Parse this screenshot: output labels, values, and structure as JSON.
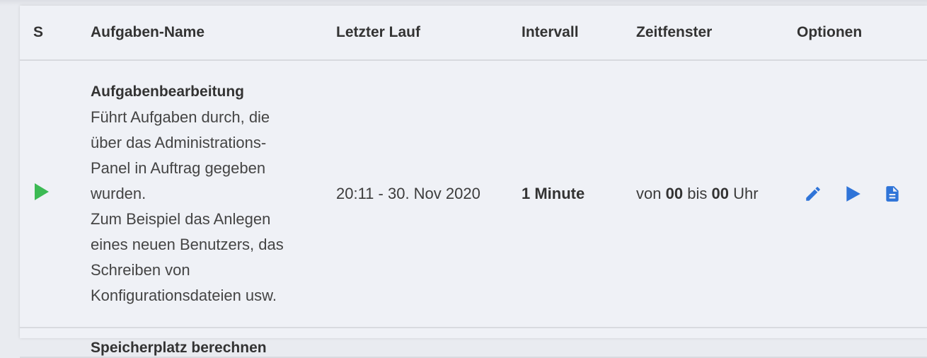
{
  "colors": {
    "status_green": "#3cba54",
    "action_blue": "#2f74d8"
  },
  "table": {
    "headers": {
      "status": "S",
      "name": "Aufgaben-Name",
      "last_run": "Letzter Lauf",
      "interval": "Intervall",
      "window": "Zeitfenster",
      "options": "Optionen"
    },
    "rows": [
      {
        "status_icon": "play-icon",
        "title": "Aufgabenbearbeitung",
        "desc_lines": [
          "Führt Aufgaben durch, die",
          "über das Administrations-",
          "Panel in Auftrag gegeben",
          "wurden.",
          "Zum Beispiel das Anlegen",
          "eines neuen Benutzers, das",
          "Schreiben von",
          "Konfigurationsdateien usw."
        ],
        "last_run": "20:11 - 30. Nov 2020",
        "interval": "1 Minute",
        "window": {
          "prefix": "von",
          "from": "00",
          "mid": "bis",
          "to": "00",
          "suffix": "Uhr"
        },
        "options": [
          "edit-pencil-icon",
          "run-play-icon",
          "document-icon"
        ]
      },
      {
        "title": "Speicherplatz berechnen"
      }
    ]
  }
}
